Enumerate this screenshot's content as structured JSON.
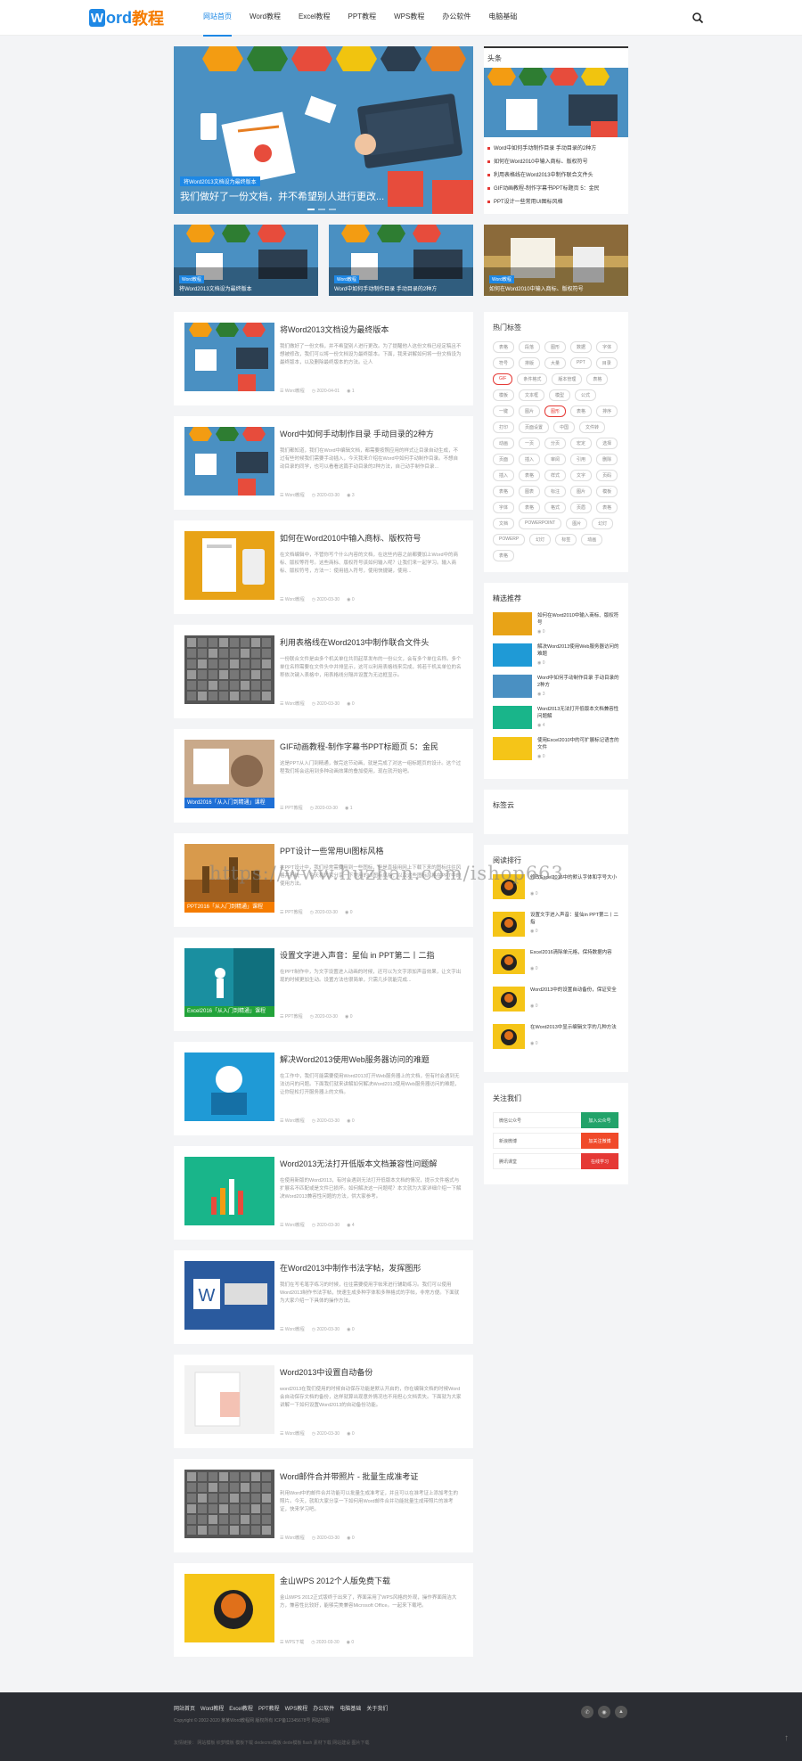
{
  "header": {
    "logo_w": "W",
    "logo_rest": "ord",
    "logo_cn": "教程",
    "nav": [
      "网站首页",
      "Word教程",
      "Excel教程",
      "PPT教程",
      "WPS教程",
      "办公软件",
      "电脑基础"
    ]
  },
  "hero": {
    "tag": "将Word2013文档设为最终版本",
    "title": "我们做好了一份文档，并不希望别人进行更改..."
  },
  "headline": {
    "title": "头条",
    "items": [
      "Word中如何手动制作目录 手动目录的2种方",
      "如何在Word2010中输入商标、版权符号",
      "利用表格线在Word2013中制作联合文件头",
      "GIF动画教程-制作字幕书PPT标题页 5：金民",
      "PPT设计一些常用UI图标风格"
    ]
  },
  "thumbs": [
    {
      "tag": "Word教程",
      "title": "将Word2013文档设为最终版本"
    },
    {
      "tag": "Word教程",
      "title": "Word中如何手动制作目录 手动目录的2种方"
    },
    {
      "tag": "Word教程",
      "title": "如何在Word2010中输入商标、版权符号"
    }
  ],
  "articles": [
    {
      "title": "将Word2013文档设为最终版本",
      "excerpt": "我们做好了一份文档，并不希望别人进行更改。为了提醒他人这份文档已经定稿且不想被修改，我们可以将一份文档设为最终版本。下面，我来讲解如何将一份文档设为最终版本，以及删除最终版本的方法。让人",
      "cat": "Word教程",
      "date": "2020-04-01",
      "views": "1",
      "banner": ""
    },
    {
      "title": "Word中如何手动制作目录 手动目录的2种方",
      "excerpt": "我们都知道，我们在Word中编辑文档，都需要按照应用的样式让目录自动生成，不过有些时候我们需要手动插入，今天我来介绍在Word中如何手动制作目录。不想自动目录的同学，也可以看看这篇手动目录的2种方法，自己动手制作目录...",
      "cat": "Word教程",
      "date": "2020-03-30",
      "views": "3",
      "banner": ""
    },
    {
      "title": "如何在Word2010中输入商标、版权符号",
      "excerpt": "在文档编辑中，不管你写个什么内容的文档，在这些内容之前都要加上Word中的商标、版权等符号。这些商标、版权符号该如何输入呢？让我们来一起学习。输入商标、版权符号，方法一：使用插入符号，使用快捷键，使用...",
      "cat": "Word教程",
      "date": "2020-03-30",
      "views": "0",
      "banner": ""
    },
    {
      "title": "利用表格线在Word2013中制作联合文件头",
      "excerpt": "一份联合文件是由多个机关单位共同起草发布的一份公文，会有多个单位名称。多个单位名称需要在文件头中并排显示，这可以利用表格线来完成，将若干机关单位的名称依次键入表格中，用表格线分隔并设置为无边框显示。",
      "cat": "Word教程",
      "date": "2020-03-30",
      "views": "0",
      "banner": ""
    },
    {
      "title": "GIF动画教程-制作字幕书PPT标题页 5：金民",
      "excerpt": "这是PPT从入门到精通，做完这节动画，就是完成了对这一组标题页的设计。这个过程我们将会运用到多种动画效果的叠加使用，现在就开始吧。",
      "cat": "PPT教程",
      "date": "2020-03-30",
      "views": "1",
      "banner": "Word2016「从入门到精通」课程",
      "bannerColor": "#1e6fd6"
    },
    {
      "title": "PPT设计一些常用UI图标风格",
      "excerpt": "在PPT设计中，我们经常需要用到一些图标，但是直接用网上下载下来的图标往往风格并不统一。今天和大家分享一下常用的UI图标风格，以及这些图标风格在PPT中的使用方法。",
      "cat": "PPT教程",
      "date": "2020-03-30",
      "views": "0",
      "banner": "PPT2016「从入门到精通」课程",
      "bannerColor": "#f57c00"
    },
    {
      "title": "设置文字进入声音：星仙 in PPT第二丨二指",
      "excerpt": "在PPT制作中，为文字设置进入动画的时候，还可以为文字添加声音效果，让文字出现的时候更加生动。设置方法也很简单，只需几步就能完成...",
      "cat": "PPT教程",
      "date": "2020-03-30",
      "views": "0",
      "banner": "Excel2016「从入门到精通」课程",
      "bannerColor": "#22a33a"
    },
    {
      "title": "解决Word2013使用Web服务器访问的难题",
      "excerpt": "在工作中，我们可能需要使用Word2013打开Web服务器上的文档，但有时会遇到无法访问的问题。下面我们就来讲解如何解决Word2013使用Web服务器访问的难题，让你轻松打开服务器上的文档。",
      "cat": "Word教程",
      "date": "2020-03-30",
      "views": "0",
      "banner": ""
    },
    {
      "title": "Word2013无法打开低版本文档兼容性问题解",
      "excerpt": "在使用新版的Word2013，有时会遇到无法打开低版本文档的情况，提示文件格式与扩展名不匹配或是文件已损坏。如何解决这一问题呢？本文就为大家详细介绍一下解决Word2013兼容性问题的方法，供大家参考。",
      "cat": "Word教程",
      "date": "2020-03-30",
      "views": "4",
      "banner": ""
    },
    {
      "title": "在Word2013中制作书法字帖，发挥图形",
      "excerpt": "我们在写毛笔字练习的时候，往往需要使用字帖来进行辅助练习。我们可以使用Word2013制作书法字帖，快速生成多种字体和多种格式的字帖，非常方便。下面就为大家介绍一下具体的操作方法。",
      "cat": "Word教程",
      "date": "2020-03-30",
      "views": "0",
      "banner": ""
    },
    {
      "title": "Word2013中设置自动备份",
      "excerpt": "word2013在我们使用的时候自动保存功能是默认开启的，你在编辑文档的时候Word会自动保存文档的备份，这样就算出现意外情况也不用担心文档丢失。下面就为大家讲解一下如何设置Word2013的自动备份功能。",
      "cat": "Word教程",
      "date": "2020-03-30",
      "views": "0",
      "banner": ""
    },
    {
      "title": "Word邮件合并带照片 - 批量生成准考证",
      "excerpt": "利用Word中的邮件合并功能可以批量生成准考证，并且可以在准考证上添加考生的照片。今天，就和大家分享一下如何用Word邮件合并功能批量生成带照片的准考证，快来学习吧。",
      "cat": "Word教程",
      "date": "2020-03-30",
      "views": "0",
      "banner": ""
    },
    {
      "title": "金山WPS 2012个人版免费下载",
      "excerpt": "金山WPS 2012正式版终于出来了，界面采用了WPS风格的外观，操作界面简洁大方，兼容性比较好，能够完美兼容Microsoft Office。一起来下载吧。",
      "cat": "WPS下载",
      "date": "2020-03-30",
      "views": "0",
      "banner": ""
    }
  ],
  "tags_widget": {
    "title": "热门标签",
    "tags": [
      "表格",
      "段落",
      "图形",
      "数据",
      "字体",
      "符号",
      "排版",
      "大量",
      "PPT",
      "目录",
      "GIF",
      "条件格式",
      "版本管理",
      "表格",
      "模板",
      "文本框",
      "模型",
      "公式",
      "一键",
      "图片",
      "图形",
      "表格",
      "排序",
      "打印",
      "页面设置",
      "中国",
      "文件转",
      "动画",
      "一页",
      "分页",
      "宏定",
      "选择",
      "页面",
      "插入",
      "审阅",
      "引用",
      "删除",
      "插入",
      "表格",
      "样式",
      "文字",
      "页码",
      "表格",
      "图表",
      "标注",
      "图片",
      "模板",
      "字体",
      "表格",
      "格式",
      "页眉",
      "表格",
      "文档",
      "POWERPOINT",
      "图片",
      "幻灯",
      "POWERP",
      "幻灯",
      "标签",
      "动画",
      "表格"
    ],
    "red": [
      10,
      20
    ]
  },
  "recommend": {
    "title": "精选推荐",
    "items": [
      {
        "title": "如何在Word2010中输入商标、版权符号",
        "views": "0"
      },
      {
        "title": "解决Word2013使用Web服务器访问的难题",
        "views": "0"
      },
      {
        "title": "Word中如何手动制作目录 手动目录的2种方",
        "views": "3"
      },
      {
        "title": "Word2013无法打开低版本文档兼容性问题解",
        "views": "4"
      },
      {
        "title": "使用Excel2010中的可扩展标记语言的文件",
        "views": "0"
      }
    ]
  },
  "empty_widget": {
    "title": "标签云"
  },
  "ranking": {
    "title": "阅读排行",
    "items": [
      {
        "title": "修改Excel2016中的默认字体和字号大小",
        "views": "0"
      },
      {
        "title": "设置文字进入声音：星仙in PPT第二丨二指",
        "views": "0"
      },
      {
        "title": "Excel2016清除单元格，保持数据内容",
        "views": "0"
      },
      {
        "title": "Word2013中的设置自动备份，保证安全",
        "views": "0"
      },
      {
        "title": "在Word2013中显示编辑文字的几种方法",
        "views": "0"
      }
    ]
  },
  "follow": {
    "title": "关注我们",
    "rows": [
      {
        "label": "微信公众号",
        "btn": "加入公众号",
        "color": "#22a36a"
      },
      {
        "label": "新浪微博",
        "btn": "加关注微博",
        "color": "#f04a2a"
      },
      {
        "label": "腾讯课堂",
        "btn": "在线学习",
        "color": "#e53935"
      }
    ]
  },
  "watermark": "https://www.huzhan.com/ishop663",
  "footer": {
    "links": [
      "网站首页",
      "Word教程",
      "Excel教程",
      "PPT教程",
      "WPS教程",
      "办公软件",
      "电脑基础",
      "关于我们"
    ],
    "copyright": "Copyright © 2002-2020 某某Word教程网 版权所有 ICP备12345678号 网站地图",
    "friends": "友情链接：  网站模板  织梦模板  模板下载  dedecms模板  dede模板  flash  素材下载  网站建设  图片下载"
  }
}
